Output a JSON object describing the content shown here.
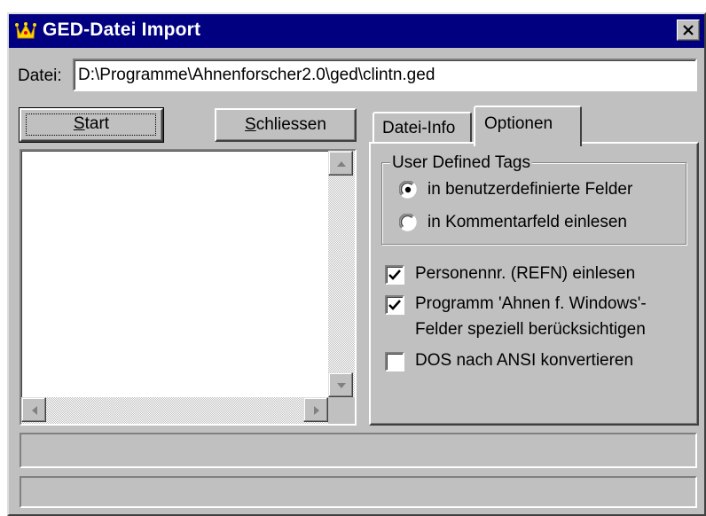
{
  "window": {
    "title": "GED-Datei Import",
    "title_bar_color": "#000080",
    "face_color": "#c0c0c0",
    "icons": {
      "app": "crown-icon",
      "close": "close-icon"
    }
  },
  "file": {
    "label": "Datei:",
    "value": "D:\\Programme\\Ahnenforscher2.0\\ged\\clintn.ged"
  },
  "buttons": {
    "start": {
      "label": "Start",
      "mnemonic": "S"
    },
    "close": {
      "label": "Schliessen",
      "mnemonic": "S"
    }
  },
  "tabs": [
    {
      "label": "Datei-Info",
      "active": false
    },
    {
      "label": "Optionen",
      "active": true
    }
  ],
  "options": {
    "group_title": "User Defined Tags",
    "radios": [
      {
        "label": "in benutzerdefinierte Felder",
        "selected": true
      },
      {
        "label": "in Kommentarfeld einlesen",
        "selected": false
      }
    ],
    "checkboxes": [
      {
        "label": "Personennr. (REFN) einlesen",
        "checked": true
      },
      {
        "label_line1": "Programm 'Ahnen f. Windows'-",
        "label_line2": "Felder speziell berücksichtigen",
        "checked": true
      },
      {
        "label": "DOS nach ANSI konvertieren",
        "checked": false
      }
    ]
  },
  "status_bars": [
    "",
    ""
  ]
}
